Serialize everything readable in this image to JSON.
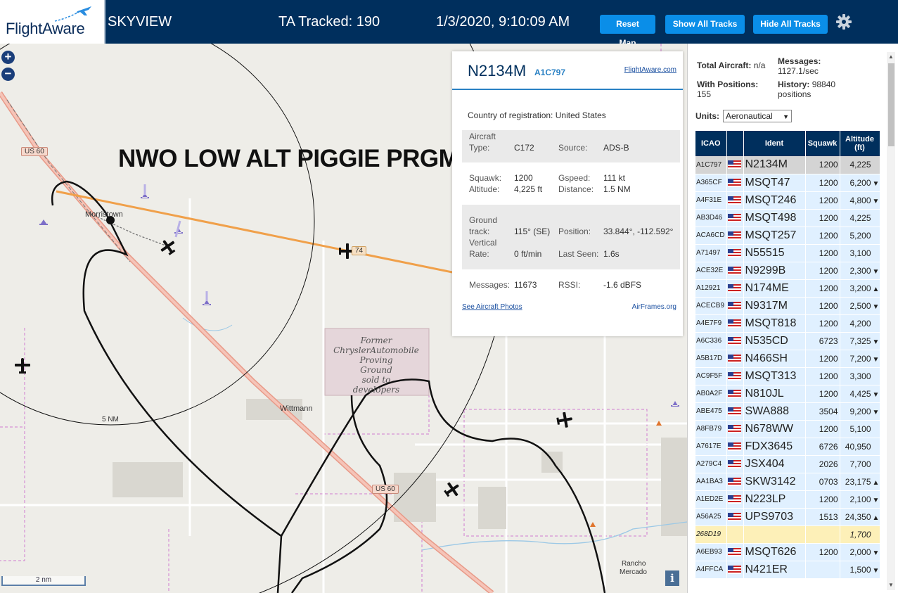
{
  "header": {
    "logo_text": "FlightAware",
    "app_name": "SKYVIEW",
    "tracked": "TA Tracked: 190",
    "datetime": "1/3/2020, 9:10:09 AM",
    "reset_label": "Reset Map",
    "show_label": "Show All Tracks",
    "hide_label": "Hide All Tracks"
  },
  "map": {
    "banner": "NWO LOW ALT PIGGIE PRGM",
    "places": {
      "morristown": "Morristown",
      "wittmann": "Wittmann",
      "rancho": "Rancho",
      "mercado": "Mercado"
    },
    "roads": {
      "us60_top": "US 60",
      "us60_bottom": "US 60",
      "road74": "74"
    },
    "proving_ground": [
      "Former",
      "ChryslerAutomobile",
      "Proving",
      "Ground",
      "sold to",
      "developers"
    ],
    "range_ring": "5 NM",
    "scale": "2 nm"
  },
  "popup": {
    "callsign": "N2134M",
    "icao": "A1C797",
    "fa_link": "FlightAware.com",
    "country": "Country of registration: United States",
    "aircraft_type_label": "Aircraft Type:",
    "aircraft_type_label_l1": "Aircraft",
    "aircraft_type_label_l2": "Type:",
    "aircraft_type": "C172",
    "source_label": "Source:",
    "source": "ADS-B",
    "squawk_label": "Squawk:",
    "squawk": "1200",
    "gspeed_label": "Gspeed:",
    "gspeed": "111 kt",
    "altitude_label": "Altitude:",
    "altitude": "4,225 ft",
    "distance_label": "Distance:",
    "distance": "1.5 NM",
    "track_label_l1": "Ground",
    "track_label_l2": "track:",
    "track": "115° (SE)",
    "position_label": "Position:",
    "position": "33.844°, -112.592°",
    "vrate_label_l1": "Vertical",
    "vrate_label_l2": "Rate:",
    "vrate": "0 ft/min",
    "lastseen_label": "Last Seen:",
    "lastseen": "1.6s",
    "messages_label": "Messages:",
    "messages": "11673",
    "rssi_label": "RSSI:",
    "rssi": "-1.6 dBFS",
    "photos_link": "See Aircraft Photos",
    "airframes_link": "AirFrames.org"
  },
  "panel": {
    "total_label": "Total Aircraft:",
    "total_value": "n/a",
    "messages_label": "Messages:",
    "messages_value": "1127.1/sec",
    "positions_label": "With Positions:",
    "positions_value": "155",
    "history_label": "History:",
    "history_value": "98840",
    "history_unit": "positions",
    "units_label": "Units:",
    "units_value": "Aeronautical",
    "columns": {
      "icao": "ICAO",
      "ident": "Ident",
      "squawk": "Squawk",
      "alt_l1": "Altitude",
      "alt_l2": "(ft)"
    },
    "rows": [
      {
        "icao": "A1C797",
        "ident": "N2134M",
        "squawk": "1200",
        "alt": "4,225",
        "trend": ""
      },
      {
        "icao": "A365CF",
        "ident": "MSQT47",
        "squawk": "1200",
        "alt": "6,200",
        "trend": "▼"
      },
      {
        "icao": "A4F31E",
        "ident": "MSQT246",
        "squawk": "1200",
        "alt": "4,800",
        "trend": "▼"
      },
      {
        "icao": "AB3D46",
        "ident": "MSQT498",
        "squawk": "1200",
        "alt": "4,225",
        "trend": ""
      },
      {
        "icao": "ACA6CD",
        "ident": "MSQT257",
        "squawk": "1200",
        "alt": "5,200",
        "trend": ""
      },
      {
        "icao": "A71497",
        "ident": "N55515",
        "squawk": "1200",
        "alt": "3,100",
        "trend": ""
      },
      {
        "icao": "ACE32E",
        "ident": "N9299B",
        "squawk": "1200",
        "alt": "2,300",
        "trend": "▼"
      },
      {
        "icao": "A12921",
        "ident": "N174ME",
        "squawk": "1200",
        "alt": "3,200",
        "trend": "▲"
      },
      {
        "icao": "ACECB9",
        "ident": "N9317M",
        "squawk": "1200",
        "alt": "2,500",
        "trend": "▼"
      },
      {
        "icao": "A4E7F9",
        "ident": "MSQT818",
        "squawk": "1200",
        "alt": "4,200",
        "trend": ""
      },
      {
        "icao": "A6C336",
        "ident": "N535CD",
        "squawk": "6723",
        "alt": "7,325",
        "trend": "▼"
      },
      {
        "icao": "A5B17D",
        "ident": "N466SH",
        "squawk": "1200",
        "alt": "7,200",
        "trend": "▼"
      },
      {
        "icao": "AC9F5F",
        "ident": "MSQT313",
        "squawk": "1200",
        "alt": "3,300",
        "trend": ""
      },
      {
        "icao": "AB0A2F",
        "ident": "N810JL",
        "squawk": "1200",
        "alt": "4,425",
        "trend": "▼"
      },
      {
        "icao": "ABE475",
        "ident": "SWA888",
        "squawk": "3504",
        "alt": "9,200",
        "trend": "▼"
      },
      {
        "icao": "A8FB79",
        "ident": "N678WW",
        "squawk": "1200",
        "alt": "5,100",
        "trend": ""
      },
      {
        "icao": "A7617E",
        "ident": "FDX3645",
        "squawk": "6726",
        "alt": "40,950",
        "trend": ""
      },
      {
        "icao": "A279C4",
        "ident": "JSX404",
        "squawk": "2026",
        "alt": "7,700",
        "trend": ""
      },
      {
        "icao": "AA1BA3",
        "ident": "SKW3142",
        "squawk": "0703",
        "alt": "23,175",
        "trend": "▲"
      },
      {
        "icao": "A1ED2E",
        "ident": "N223LP",
        "squawk": "1200",
        "alt": "2,100",
        "trend": "▼"
      },
      {
        "icao": "A56A25",
        "ident": "UPS9703",
        "squawk": "1513",
        "alt": "24,350",
        "trend": "▲"
      },
      {
        "icao": "268D19",
        "ident": "",
        "squawk": "",
        "alt": "1,700",
        "trend": ""
      },
      {
        "icao": "A6EB93",
        "ident": "MSQT626",
        "squawk": "1200",
        "alt": "2,000",
        "trend": "▼"
      },
      {
        "icao": "A4FFCA",
        "ident": "N421ER",
        "squawk": "",
        "alt": "1,500",
        "trend": "▼"
      }
    ]
  },
  "colors": {
    "header": "#002f5d",
    "button": "#0a8ee8",
    "row": "#e0f0ff",
    "selected": "#d4d4d4",
    "no_ident": "#fdf0b8"
  }
}
